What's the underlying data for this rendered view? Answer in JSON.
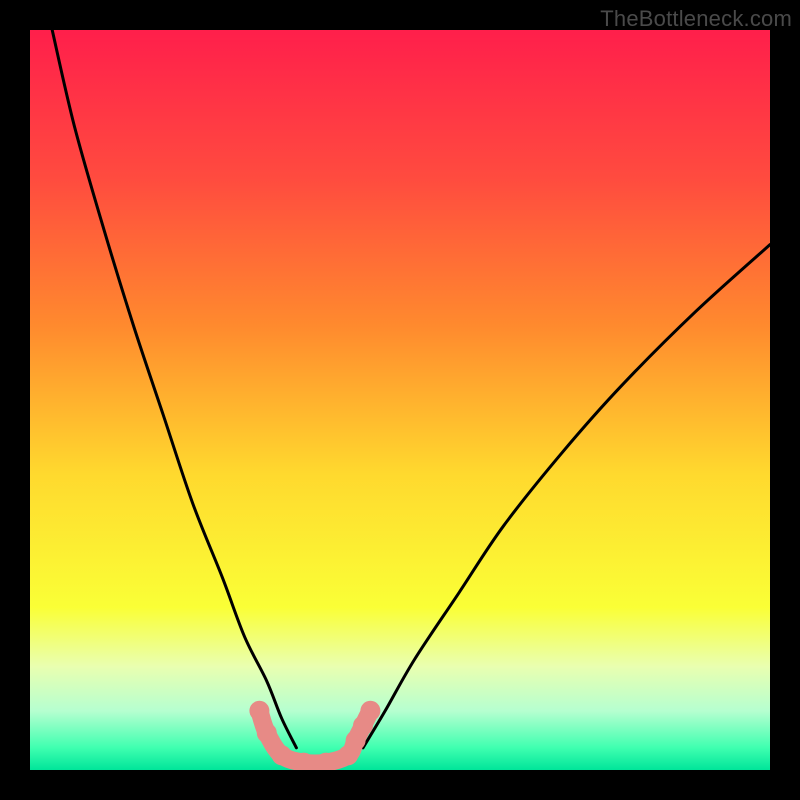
{
  "watermark": "TheBottleneck.com",
  "chart_data": {
    "type": "line",
    "title": "",
    "xlabel": "",
    "ylabel": "",
    "xlim": [
      0,
      100
    ],
    "ylim": [
      0,
      100
    ],
    "grid": false,
    "legend": false,
    "gradient_stops": [
      {
        "offset": 0.0,
        "color": "#ff1f4b"
      },
      {
        "offset": 0.2,
        "color": "#ff4b3f"
      },
      {
        "offset": 0.4,
        "color": "#ff8a2e"
      },
      {
        "offset": 0.6,
        "color": "#ffd92e"
      },
      {
        "offset": 0.78,
        "color": "#faff36"
      },
      {
        "offset": 0.86,
        "color": "#e9ffb0"
      },
      {
        "offset": 0.92,
        "color": "#b6ffd0"
      },
      {
        "offset": 0.97,
        "color": "#3fffb0"
      },
      {
        "offset": 1.0,
        "color": "#00e59a"
      }
    ],
    "series": [
      {
        "name": "left-curve",
        "x": [
          3,
          6,
          10,
          14,
          18,
          22,
          26,
          29,
          32,
          34,
          36
        ],
        "values": [
          100,
          87,
          73,
          60,
          48,
          36,
          26,
          18,
          12,
          7,
          3
        ]
      },
      {
        "name": "right-curve",
        "x": [
          45,
          48,
          52,
          58,
          64,
          72,
          80,
          90,
          100
        ],
        "values": [
          3,
          8,
          15,
          24,
          33,
          43,
          52,
          62,
          71
        ]
      },
      {
        "name": "valley-marker",
        "x": [
          31,
          32,
          34,
          37,
          40,
          43,
          44,
          45,
          46
        ],
        "values": [
          8,
          5,
          2,
          1,
          1,
          2,
          4,
          6,
          8
        ]
      }
    ],
    "marker_color": "#e78a86",
    "curve_color": "#000000"
  }
}
